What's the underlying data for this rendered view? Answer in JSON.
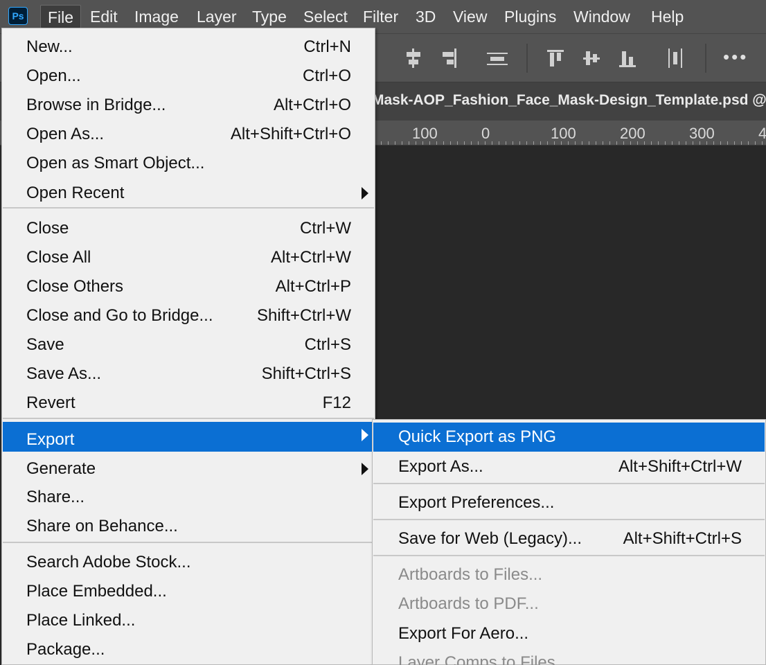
{
  "app": {
    "logo_text": "Ps"
  },
  "menubar": {
    "items": [
      "File",
      "Edit",
      "Image",
      "Layer",
      "Type",
      "Select",
      "Filter",
      "3D",
      "View",
      "Plugins",
      "Window",
      "Help"
    ],
    "active": "File"
  },
  "document": {
    "tab_title": "tMask-AOP_Fashion_Face_Mask-Design_Template.psd @"
  },
  "ruler": {
    "labels": [
      "100",
      "0",
      "100",
      "200",
      "300",
      "4"
    ]
  },
  "file_menu": {
    "items": [
      {
        "label": "New...",
        "shortcut": "Ctrl+N"
      },
      {
        "label": "Open...",
        "shortcut": "Ctrl+O"
      },
      {
        "label": "Browse in Bridge...",
        "shortcut": "Alt+Ctrl+O"
      },
      {
        "label": "Open As...",
        "shortcut": "Alt+Shift+Ctrl+O"
      },
      {
        "label": "Open as Smart Object...",
        "shortcut": ""
      },
      {
        "label": "Open Recent",
        "shortcut": ""
      },
      {
        "label": "Close",
        "shortcut": "Ctrl+W"
      },
      {
        "label": "Close All",
        "shortcut": "Alt+Ctrl+W"
      },
      {
        "label": "Close Others",
        "shortcut": "Alt+Ctrl+P"
      },
      {
        "label": "Close and Go to Bridge...",
        "shortcut": "Shift+Ctrl+W"
      },
      {
        "label": "Save",
        "shortcut": "Ctrl+S"
      },
      {
        "label": "Save As...",
        "shortcut": "Shift+Ctrl+S"
      },
      {
        "label": "Revert",
        "shortcut": "F12"
      },
      {
        "label": "Export",
        "shortcut": ""
      },
      {
        "label": "Generate",
        "shortcut": ""
      },
      {
        "label": "Share...",
        "shortcut": ""
      },
      {
        "label": "Share on Behance...",
        "shortcut": ""
      },
      {
        "label": "Search Adobe Stock...",
        "shortcut": ""
      },
      {
        "label": "Place Embedded...",
        "shortcut": ""
      },
      {
        "label": "Place Linked...",
        "shortcut": ""
      },
      {
        "label": "Package...",
        "shortcut": ""
      }
    ]
  },
  "export_menu": {
    "items": [
      {
        "label": "Quick Export as PNG",
        "shortcut": ""
      },
      {
        "label": "Export As...",
        "shortcut": "Alt+Shift+Ctrl+W"
      },
      {
        "label": "Export Preferences...",
        "shortcut": ""
      },
      {
        "label": "Save for Web (Legacy)...",
        "shortcut": "Alt+Shift+Ctrl+S"
      },
      {
        "label": "Artboards to Files...",
        "shortcut": ""
      },
      {
        "label": "Artboards to PDF...",
        "shortcut": ""
      },
      {
        "label": "Export For Aero...",
        "shortcut": ""
      },
      {
        "label": "Layer Comps to Files...",
        "shortcut": ""
      }
    ]
  },
  "colors": {
    "highlight": "#0b6fd3",
    "menu_bg": "#f0f0f0",
    "chrome_bg": "#535353",
    "canvas_bg": "#282828"
  }
}
